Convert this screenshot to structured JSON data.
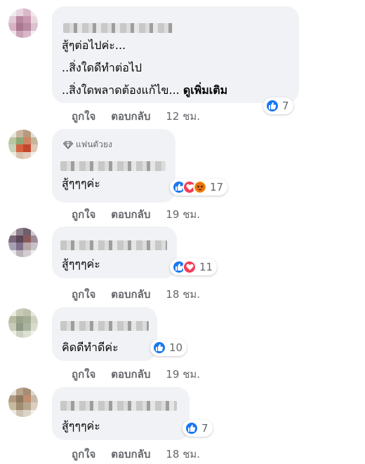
{
  "actions": {
    "like": "ถูกใจ",
    "reply": "ตอบกลับ"
  },
  "comments": [
    {
      "lines": [
        "สู้ๆต่อไปค่ะ...",
        "..สิ่งใดดีทำต่อไป",
        "..สิ่งใดพลาดต้องแก้ไข..."
      ],
      "see_more": "ดูเพิ่มเติม",
      "reactions": [
        "like"
      ],
      "count": "7",
      "time": "12 ชม."
    },
    {
      "badge": "แฟนตัวยง",
      "lines": [
        "สู้ๆๆๆค่ะ"
      ],
      "reactions": [
        "like",
        "love",
        "angry"
      ],
      "count": "17",
      "time": "19 ชม."
    },
    {
      "lines": [
        "สู้ๆๆๆค่ะ"
      ],
      "reactions": [
        "like",
        "love"
      ],
      "count": "11",
      "time": "18 ชม."
    },
    {
      "lines": [
        "คิดดีทำดีค่ะ"
      ],
      "reactions": [
        "like"
      ],
      "count": "10",
      "time": "19 ชม."
    },
    {
      "lines": [
        "สู้ๆๆๆค่ะ"
      ],
      "reactions": [
        "like"
      ],
      "count": "7",
      "time": "18 ชม."
    }
  ],
  "colors": {
    "like": "#1877f2",
    "love": "#f33e58",
    "angry": "#f7a21b",
    "bubble": "#f0f2f5",
    "meta": "#65676b"
  }
}
